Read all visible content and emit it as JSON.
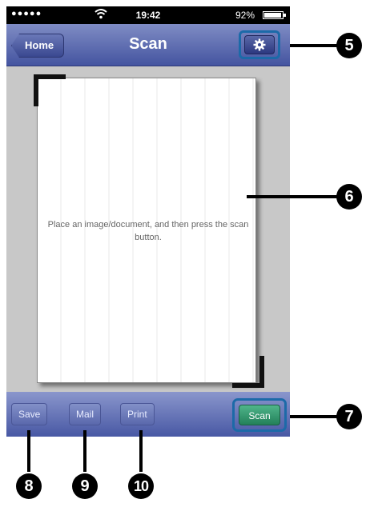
{
  "status_bar": {
    "signal": "●●●●●",
    "wifi_icon": "wifi-icon",
    "time": "19:42",
    "battery": "92%"
  },
  "nav": {
    "home_label": "Home",
    "title": "Scan",
    "settings_icon": "gear-icon"
  },
  "preview": {
    "hint": "Place an image/document, and then press the scan button."
  },
  "toolbar": {
    "save_label": "Save",
    "mail_label": "Mail",
    "print_label": "Print",
    "scan_label": "Scan"
  },
  "callouts": {
    "c5": "5",
    "c6": "6",
    "c7": "7",
    "c8": "8",
    "c9": "9",
    "c10": "10"
  },
  "colors": {
    "navbar": "#4454a0",
    "scan_button": "#23805a",
    "highlight_border": "#1c6aa8"
  }
}
